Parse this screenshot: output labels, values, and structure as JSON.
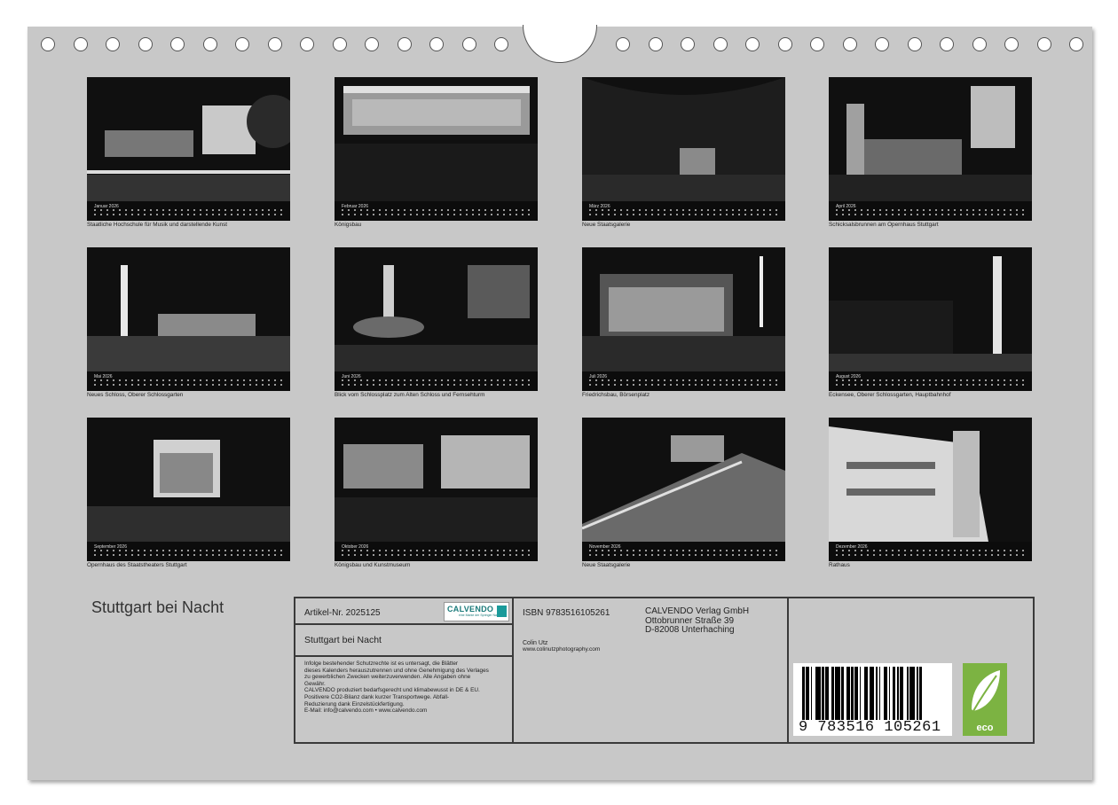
{
  "calendar_title": "Stuttgart bei Nacht",
  "months": [
    {
      "name": "Januar 2026",
      "caption": "Staatliche Hochschule für Musik und darstellende Kunst"
    },
    {
      "name": "Februar 2026",
      "caption": "Königsbau"
    },
    {
      "name": "März 2026",
      "caption": "Neue Staatsgalerie"
    },
    {
      "name": "April 2026",
      "caption": "Schicksalsbrunnen am Opernhaus Stuttgart"
    },
    {
      "name": "Mai 2026",
      "caption": "Neues Schloss, Oberer Schlossgarten"
    },
    {
      "name": "Juni 2026",
      "caption": "Blick vom Schlossplatz zum Alten Schloss und Fernsehturm"
    },
    {
      "name": "Juli 2026",
      "caption": "Friedrichsbau, Börsenplatz"
    },
    {
      "name": "August 2026",
      "caption": "Eckensee, Oberer Schlossgarten, Hauptbahnhof"
    },
    {
      "name": "September 2026",
      "caption": "Opernhaus des Staatstheaters Stuttgart"
    },
    {
      "name": "Oktober 2026",
      "caption": "Königsbau und Kunstmuseum"
    },
    {
      "name": "November 2026",
      "caption": "Neue Staatsgalerie"
    },
    {
      "name": "Dezember 2026",
      "caption": "Rathaus"
    }
  ],
  "info": {
    "artikel": "Artikel-Nr. 2025125",
    "product_title": "Stuttgart bei Nacht",
    "legal_lines": [
      "Infolge bestehender Schutzrechte ist es untersagt, die Blätter",
      "dieses Kalenders herauszutrennen und ohne Genehmigung des Verlages",
      "zu gewerblichen Zwecken weiterzuverwenden. Alle Angaben ohne",
      "Gewähr.",
      "CALVENDO produziert bedarfsgerecht und klimabewusst in DE & EU.",
      "Positivere CO2-Bilanz dank kurzer Transportwege. Abfall-",
      "Reduzierung dank Einzelstückfertigung.",
      "E-Mail: info@calvendo.com • www.calvendo.com"
    ],
    "isbn": "ISBN 9783516105261",
    "publisher_lines": [
      "CALVENDO Verlag GmbH",
      "Ottobrunner Straße 39",
      "D-82008 Unterhaching"
    ],
    "author": "Colin Utz",
    "author_url": "www.colinutzphotography.com",
    "barcode_number": "9  783516  105261",
    "calvendo_logo": "CALVENDO",
    "calvendo_logo_sub": "eine Marke der Springer Nature",
    "eco_label": "eco"
  },
  "colors": {
    "sheet": "#c8c8c8",
    "eco_green": "#7cb342",
    "calvendo_teal": "#1a9a9a"
  }
}
